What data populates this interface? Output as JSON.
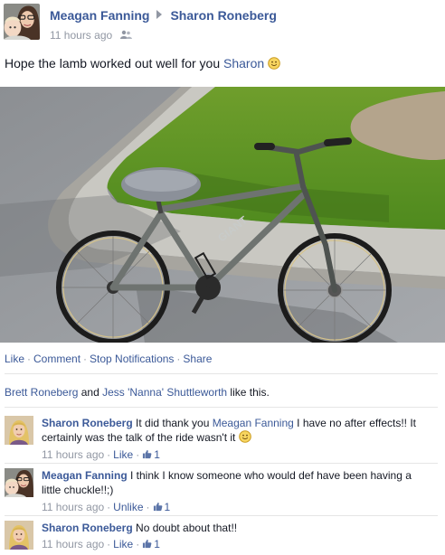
{
  "post": {
    "author": "Meagan Fanning",
    "target": "Sharon Roneberg",
    "time": "11 hours ago",
    "text_before": "Hope the lamb worked out well for you ",
    "text_tag": "Sharon"
  },
  "actions": {
    "like": "Like",
    "comment": "Comment",
    "stop_notifications": "Stop Notifications",
    "share": "Share",
    "sep": "·"
  },
  "likes": {
    "name1": "Brett Roneberg",
    "and": " and ",
    "name2": "Jess 'Nanna' Shuttleworth",
    "suffix": " like this."
  },
  "comments": [
    {
      "author": "Sharon Roneberg",
      "text_a": " It did thank you ",
      "mention": "Meagan Fanning",
      "text_b": " I have no after effects!! It certainly was the talk of the ride wasn't it ",
      "time": "11 hours ago",
      "action": "Like",
      "like_count": "1"
    },
    {
      "author": "Meagan Fanning",
      "text_a": " I think I know someone who would def have been having a little chuckle!!;)",
      "time": "11 hours ago",
      "action": "Unlike",
      "like_count": "1"
    },
    {
      "author": "Sharon Roneberg",
      "text_a": " No doubt about that!!",
      "time": "11 hours ago",
      "action": "Like",
      "like_count": "1"
    }
  ],
  "icons": {
    "audience": "friends-audience-icon",
    "smiley": "smiley-emoticon-icon",
    "thumbs_up": "thumbs-up-icon",
    "arrow": "triangle-right-icon"
  },
  "colors": {
    "link": "#3b5998",
    "meta": "#9197a3",
    "text": "#141823"
  }
}
